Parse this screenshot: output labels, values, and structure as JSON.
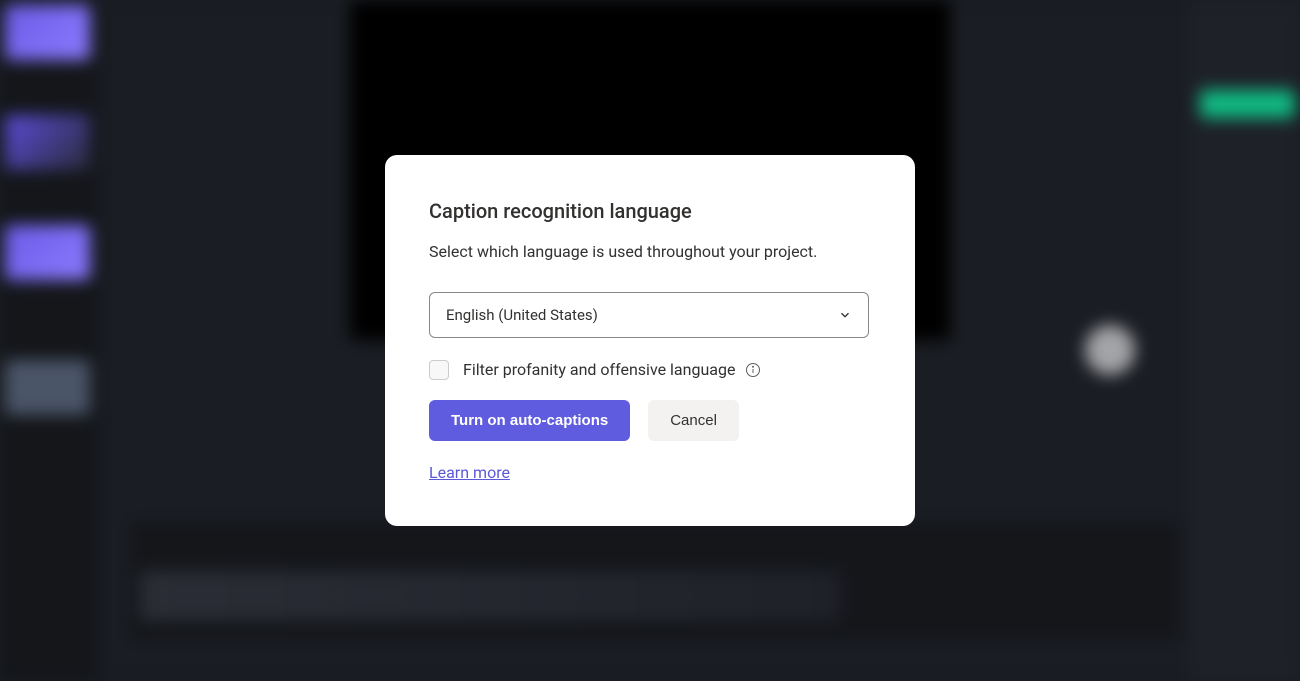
{
  "modal": {
    "title": "Caption recognition language",
    "description": "Select which language is used throughout your project.",
    "dropdown": {
      "selected": "English (United States)"
    },
    "checkbox": {
      "label": "Filter profanity and offensive language",
      "checked": false
    },
    "buttons": {
      "primary": "Turn on auto-captions",
      "secondary": "Cancel"
    },
    "learn_more": "Learn more"
  },
  "colors": {
    "primary": "#605ce0",
    "text": "#323130"
  }
}
